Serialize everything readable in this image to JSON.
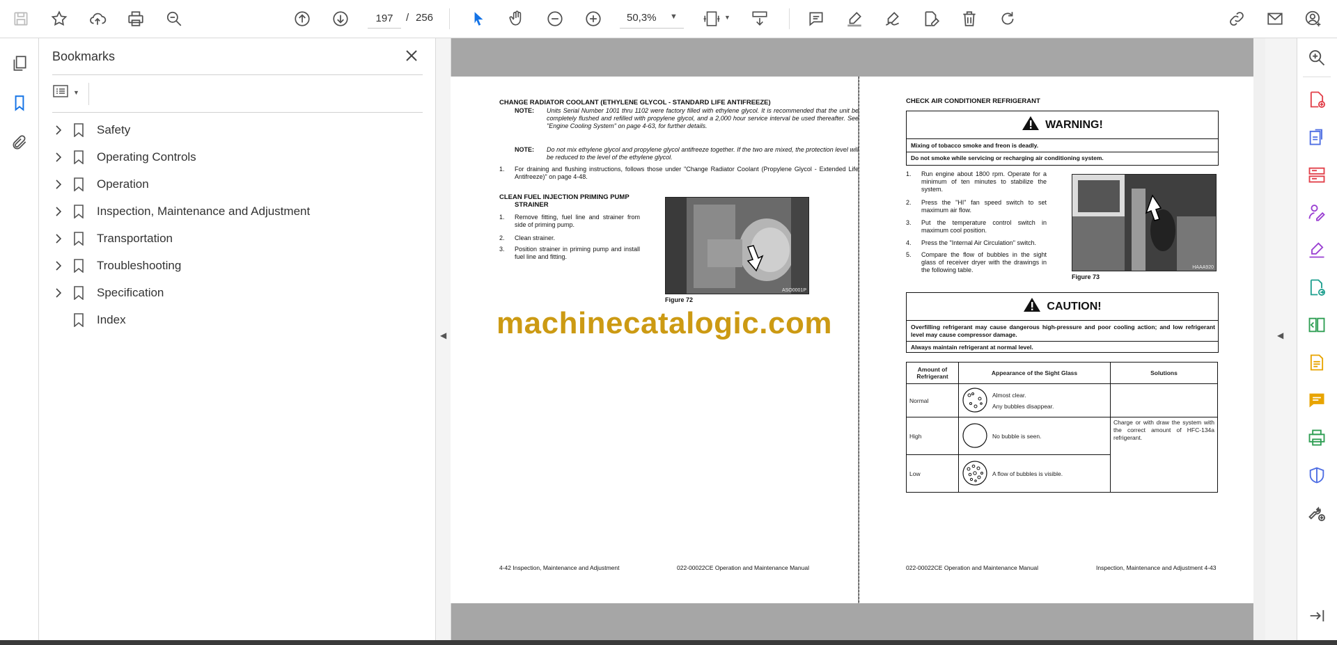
{
  "toolbar": {
    "current_page": "197",
    "page_separator": "/",
    "total_pages": "256",
    "zoom": "50,3%"
  },
  "bookmarks": {
    "title": "Bookmarks",
    "items": [
      {
        "label": "Safety",
        "expandable": true
      },
      {
        "label": "Operating Controls",
        "expandable": true
      },
      {
        "label": "Operation",
        "expandable": true
      },
      {
        "label": "Inspection, Maintenance and Adjustment",
        "expandable": true
      },
      {
        "label": "Transportation",
        "expandable": true
      },
      {
        "label": "Troubleshooting",
        "expandable": true
      },
      {
        "label": "Specification",
        "expandable": true
      },
      {
        "label": "Index",
        "expandable": false
      }
    ]
  },
  "left_page": {
    "heading1": "CHANGE RADIATOR COOLANT (ETHYLENE GLYCOL - STANDARD LIFE ANTIFREEZE)",
    "note1_label": "NOTE:",
    "note1_text": "Units Serial Number 1001 thru 1102 were factory filled with ethylene glycol. It is recommended that the unit be completely flushed and refilled with propylene glycol, and a 2,000 hour service interval be used thereafter. See \"Engine Cooling System\" on page 4-63, for further details.",
    "note2_label": "NOTE:",
    "note2_text": "Do not mix ethylene glycol and propylene glycol antifreeze together. If the two are mixed, the protection level will be reduced to the level of the ethylene glycol.",
    "step1_num": "1.",
    "step1_text": "For draining and flushing instructions, follows those under \"Change Radiator Coolant (Propylene Glycol - Extended Life Antifreeze)\" on page 4-48.",
    "heading2_line1": "CLEAN FUEL INJECTION PRIMING PUMP",
    "heading2_line2": "STRAINER",
    "steps": [
      {
        "num": "1.",
        "text": "Remove fitting, fuel line and strainer from side of priming pump."
      },
      {
        "num": "2.",
        "text": "Clean strainer."
      },
      {
        "num": "3.",
        "text": "Position strainer in priming pump and install fuel line and fitting."
      }
    ],
    "photo_code": "ASO0001P",
    "figure_caption": "Figure 72",
    "footer_left": "4-42  Inspection, Maintenance and Adjustment",
    "footer_right": "022-00022CE Operation and Maintenance Manual"
  },
  "watermark": "machinecatalogic.com",
  "right_page": {
    "heading": "CHECK AIR CONDITIONER REFRIGERANT",
    "warning_title": "WARNING!",
    "warning_line1": "Mixing of tobacco smoke and freon is deadly.",
    "warning_line2": "Do not smoke while servicing or recharging air conditioning system.",
    "steps": [
      {
        "num": "1.",
        "text": "Run engine about 1800 rpm. Operate for a minimum of ten minutes to stabilize the system."
      },
      {
        "num": "2.",
        "text": "Press the \"HI\" fan speed switch to set maximum air flow."
      },
      {
        "num": "3.",
        "text": "Put the temperature control switch in maximum cool position."
      },
      {
        "num": "4.",
        "text": "Press the \"Internal Air Circulation\" switch."
      },
      {
        "num": "5.",
        "text": "Compare the flow of bubbles in the sight glass of receiver dryer with the drawings in the following table."
      }
    ],
    "photo_code": "HAAA920",
    "figure_caption": "Figure 73",
    "caution_title": "CAUTION!",
    "caution_line1": "Overfilling refrigerant may cause dangerous high-pressure and poor cooling action; and low refrigerant level may cause compressor damage.",
    "caution_line2": "Always maintain refrigerant at normal level.",
    "table": {
      "headers": [
        "Amount of Refrigerant",
        "Appearance of the Sight Glass",
        "Solutions"
      ],
      "rows": [
        {
          "amount": "Normal",
          "appearance": "Almost clear.",
          "appearance2": "Any bubbles disappear."
        },
        {
          "amount": "High",
          "appearance": "No bubble is seen."
        },
        {
          "amount": "Low",
          "appearance": "A flow of bubbles is visible."
        }
      ],
      "solution": "Charge or with draw the system with the correct amount of HFC-134a refrigerant."
    },
    "footer_left": "022-00022CE Operation and Maintenance Manual",
    "footer_right": "Inspection, Maintenance and Adjustment 4-43"
  },
  "colors": {
    "accent": "#1473e6",
    "watermark": "#cc9a13",
    "viewer_background": "#a6a6a6"
  }
}
